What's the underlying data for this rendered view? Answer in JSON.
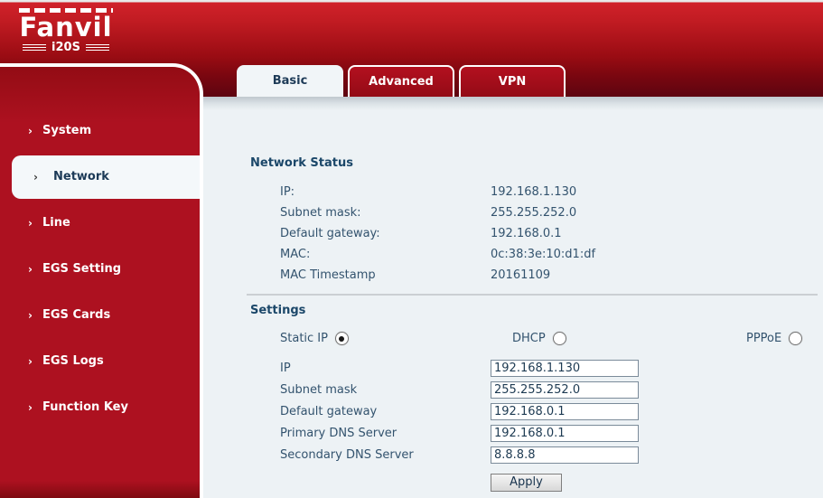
{
  "logo": {
    "brand": "Fanvil",
    "model": "i20S"
  },
  "tabs": [
    {
      "label": "Basic",
      "active": true
    },
    {
      "label": "Advanced",
      "active": false
    },
    {
      "label": "VPN",
      "active": false
    }
  ],
  "sidebar": {
    "items": [
      {
        "label": "System",
        "selected": false
      },
      {
        "label": "Network",
        "selected": true
      },
      {
        "label": "Line",
        "selected": false
      },
      {
        "label": "EGS Setting",
        "selected": false
      },
      {
        "label": "EGS Cards",
        "selected": false
      },
      {
        "label": "EGS Logs",
        "selected": false
      },
      {
        "label": "Function Key",
        "selected": false
      }
    ]
  },
  "network_status": {
    "title": "Network Status",
    "rows": [
      {
        "label": "IP:",
        "value": "192.168.1.130"
      },
      {
        "label": "Subnet mask:",
        "value": "255.255.252.0"
      },
      {
        "label": "Default gateway:",
        "value": "192.168.0.1"
      },
      {
        "label": "MAC:",
        "value": "0c:38:3e:10:d1:df"
      },
      {
        "label": "MAC Timestamp",
        "value": "20161109"
      }
    ]
  },
  "settings": {
    "title": "Settings",
    "modes": [
      {
        "label": "Static IP",
        "checked": true
      },
      {
        "label": "DHCP",
        "checked": false
      },
      {
        "label": "PPPoE",
        "checked": false
      }
    ],
    "fields": [
      {
        "label": "IP",
        "value": "192.168.1.130"
      },
      {
        "label": "Subnet mask",
        "value": "255.255.252.0"
      },
      {
        "label": "Default gateway",
        "value": "192.168.0.1"
      },
      {
        "label": "Primary DNS Server",
        "value": "192.168.0.1"
      },
      {
        "label": "Secondary DNS Server",
        "value": "8.8.8.8"
      }
    ],
    "apply_label": "Apply"
  },
  "colors": {
    "brand_red": "#ad1120",
    "header_red_top": "#d0222a",
    "header_red_bottom": "#9a0c13",
    "strip_dark": "#5d0410",
    "accent_text": "#2b4d68",
    "content_bg": "#edf2f5"
  }
}
